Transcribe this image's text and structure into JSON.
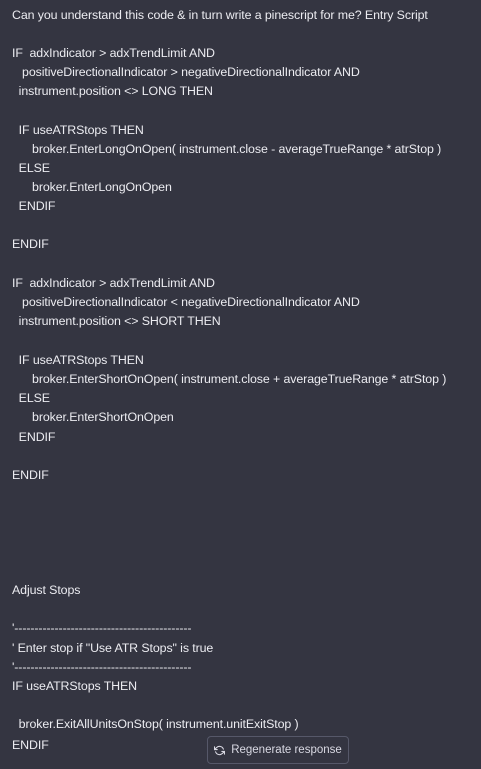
{
  "message": {
    "lines": [
      "Can you understand this code & in turn write a pinescript for me? Entry Script",
      "IF  adxIndicator > adxTrendLimit AND",
      "   positiveDirectionalIndicator > negativeDirectionalIndicator AND",
      "  instrument.position <> LONG THEN",
      "  IF useATRStops THEN",
      "      broker.EnterLongOnOpen( instrument.close - averageTrueRange * atrStop )",
      "  ELSE",
      "      broker.EnterLongOnOpen",
      "  ENDIF",
      "ENDIF",
      "IF  adxIndicator > adxTrendLimit AND",
      "   positiveDirectionalIndicator < negativeDirectionalIndicator AND",
      "  instrument.position <> SHORT THEN",
      "  IF useATRStops THEN",
      "      broker.EnterShortOnOpen( instrument.close + averageTrueRange * atrStop )",
      "  ELSE",
      "      broker.EnterShortOnOpen",
      "  ENDIF",
      "ENDIF",
      "Adjust Stops",
      "'--------------------------------------------",
      "' Enter stop if \"Use ATR Stops\" is true",
      "'--------------------------------------------",
      "IF useATRStops THEN",
      "  broker.ExitAllUnitsOnStop( instrument.unitExitStop )",
      "ENDIF"
    ]
  },
  "regenerate": {
    "label": "Regenerate response",
    "icon": "refresh-icon"
  }
}
